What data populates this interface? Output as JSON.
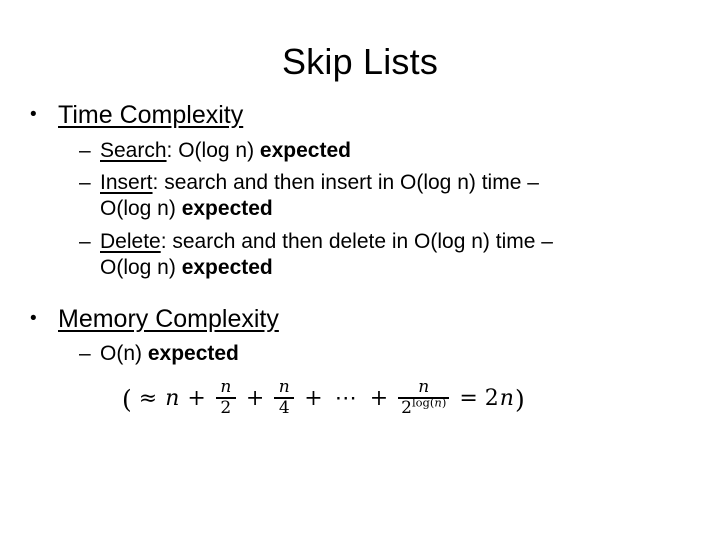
{
  "slide": {
    "title": "Skip Lists",
    "background_color": "#ffffff",
    "text_color": "#000000",
    "sections": [
      {
        "heading": "Time Complexity",
        "bullet_marker": "•",
        "items": [
          {
            "dash": "–",
            "lead": "Search",
            "rest": ": O(log n) ",
            "bold_tail": "expected",
            "line2": null,
            "line2_bold": null
          },
          {
            "dash": "–",
            "lead": "Insert",
            "rest": ": search and then insert in O(log n) time –",
            "bold_tail": null,
            "line2": "O(log n) ",
            "line2_bold": "expected"
          },
          {
            "dash": "–",
            "lead": "Delete",
            "rest": ": search and then delete in O(log n) time –",
            "bold_tail": null,
            "line2": "O(log n) ",
            "line2_bold": "expected"
          }
        ]
      },
      {
        "heading": "Memory Complexity",
        "bullet_marker": "•",
        "items": [
          {
            "dash": "–",
            "lead": null,
            "rest": "O(n) ",
            "bold_tail": "expected",
            "line2": null,
            "line2_bold": null
          }
        ]
      }
    ],
    "equation": {
      "plain_text": "(≈ n + n/2 + n/4 + ⋯ + n/2^log(n) = 2n)",
      "open_paren": "(",
      "approx": "≈",
      "term1": "n",
      "plus1": "+",
      "frac1_num": "n",
      "frac1_den": "2",
      "plus2": "+",
      "frac2_num": "n",
      "frac2_den": "4",
      "plus3": "+",
      "dots": "⋯",
      "plus4": "+",
      "frac3_num": "n",
      "frac3_den_base": "2",
      "frac3_den_exp_fn": "log",
      "frac3_den_exp_open": "(",
      "frac3_den_exp_var": "n",
      "frac3_den_exp_close": ")",
      "equals": "=",
      "result_coef": "2",
      "result_var": "n",
      "close_paren": ")"
    }
  }
}
